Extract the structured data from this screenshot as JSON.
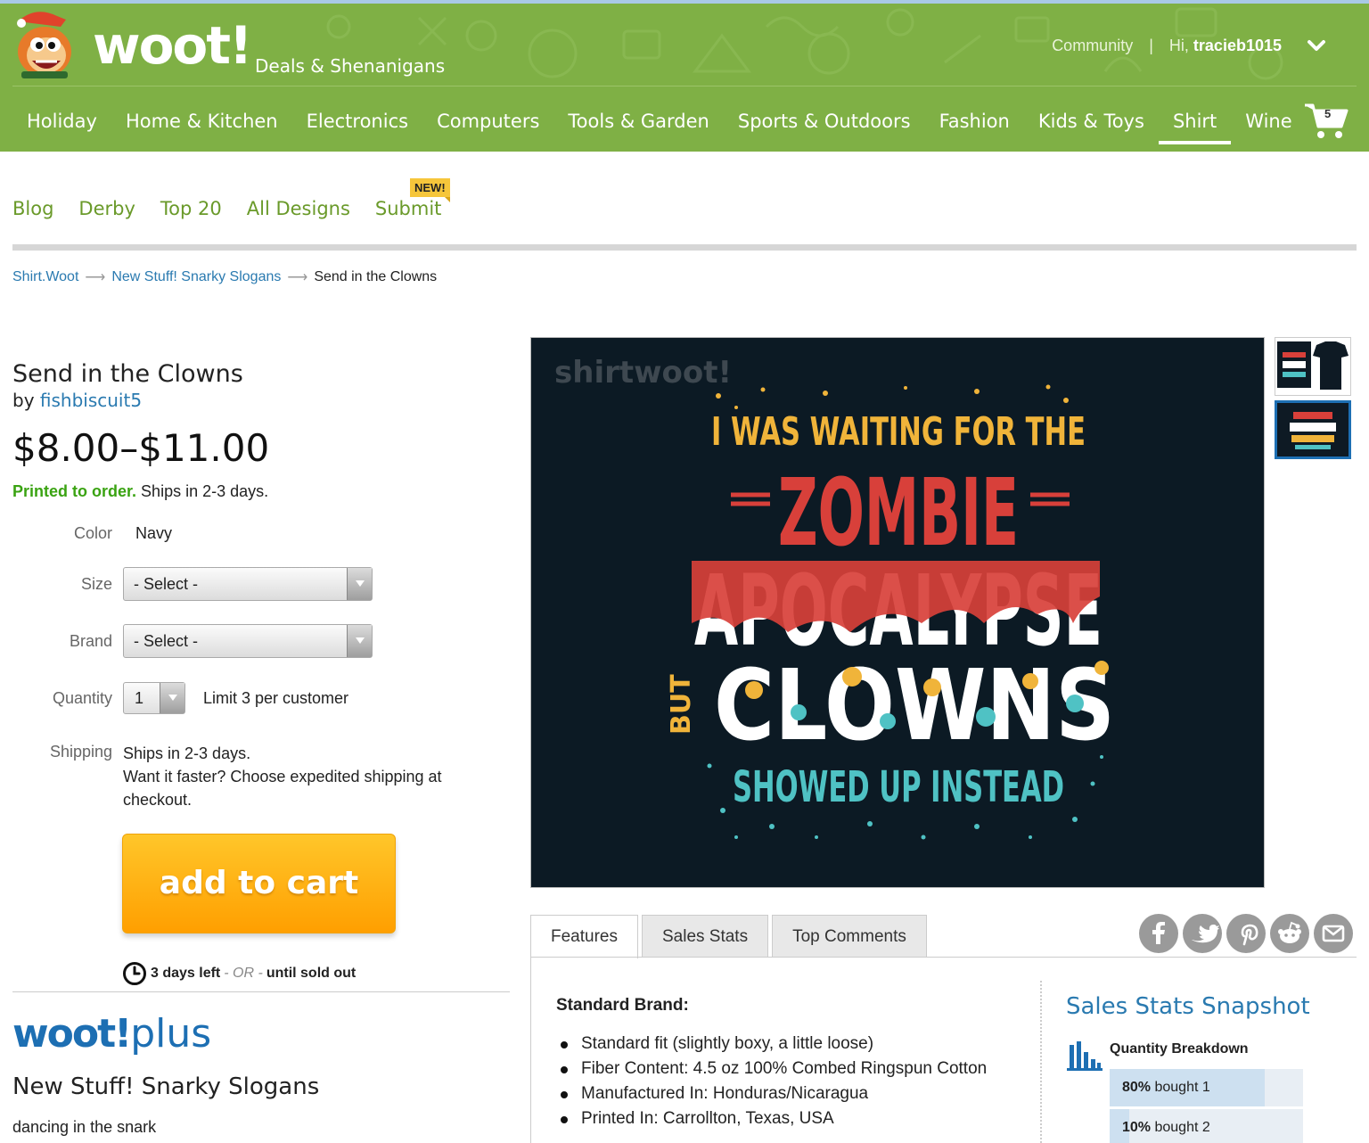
{
  "header": {
    "logo_text": "woot!",
    "tagline": "Deals & Shenanigans",
    "community_label": "Community",
    "separator": "|",
    "greeting": "Hi,",
    "username": "tracieb1015",
    "cart_count": "5",
    "brand_color": "#7fb045"
  },
  "main_nav": [
    {
      "label": "Holiday"
    },
    {
      "label": "Home & Kitchen"
    },
    {
      "label": "Electronics"
    },
    {
      "label": "Computers"
    },
    {
      "label": "Tools & Garden"
    },
    {
      "label": "Sports & Outdoors"
    },
    {
      "label": "Fashion"
    },
    {
      "label": "Kids & Toys"
    },
    {
      "label": "Shirt",
      "active": true
    },
    {
      "label": "Wine"
    }
  ],
  "sub_nav": {
    "links": [
      "Blog",
      "Derby",
      "Top 20",
      "All Designs",
      "Submit"
    ],
    "new_badge": "NEW!"
  },
  "breadcrumb": {
    "items": [
      "Shirt.Woot",
      "New Stuff! Snarky Slogans"
    ],
    "current": "Send in the Clowns",
    "arrow": "⟶"
  },
  "product": {
    "title": "Send in the Clowns",
    "by_label": "by",
    "author": "fishbiscuit5",
    "price": "$8.00–$11.00",
    "printed_label": "Printed to order.",
    "ships_label": "Ships in 2-3 days.",
    "color_label": "Color",
    "color_value": "Navy",
    "size_label": "Size",
    "size_value": "- Select -",
    "brand_label": "Brand",
    "brand_value": "- Select -",
    "quantity_label": "Quantity",
    "quantity_value": "1",
    "limit_text": "Limit 3 per customer",
    "shipping_label": "Shipping",
    "shipping_line1": "Ships in 2-3 days.",
    "shipping_line2": "Want it faster? Choose expedited shipping at checkout.",
    "add_to_cart": "add to cart",
    "time_left": "3 days left",
    "or_text": "- OR -",
    "until_text": "until sold out"
  },
  "artwork": {
    "watermark": "shirtwoot!",
    "line1": "I WAS WAITING FOR THE",
    "line2": "ZOMBIE",
    "line3": "APOCALYPSE",
    "line4_small": "BUT",
    "line4": "CLOWNS",
    "line5": "SHOWED UP INSTEAD"
  },
  "wootplus": {
    "logo_woot": "woot!",
    "logo_plus": "plus",
    "title": "New Stuff! Snarky Slogans",
    "subtitle": "dancing in the snark"
  },
  "tabs": [
    "Features",
    "Sales Stats",
    "Top Comments"
  ],
  "share_icons": [
    "facebook-icon",
    "twitter-icon",
    "pinterest-icon",
    "reddit-icon",
    "email-icon"
  ],
  "features": {
    "heading": "Standard Brand:",
    "items": [
      "Standard fit (slightly boxy, a little loose)",
      "Fiber Content: 4.5 oz 100% Combed Ringspun Cotton",
      "Manufactured In: Honduras/Nicaragua",
      "Printed In: Carrollton, Texas, USA"
    ]
  },
  "sales_snapshot": {
    "title": "Sales Stats Snapshot",
    "subtitle": "Quantity Breakdown",
    "rows": [
      {
        "pct": "80%",
        "label": "bought 1",
        "value": 0.8
      },
      {
        "pct": "10%",
        "label": "bought 2",
        "value": 0.1
      }
    ]
  }
}
